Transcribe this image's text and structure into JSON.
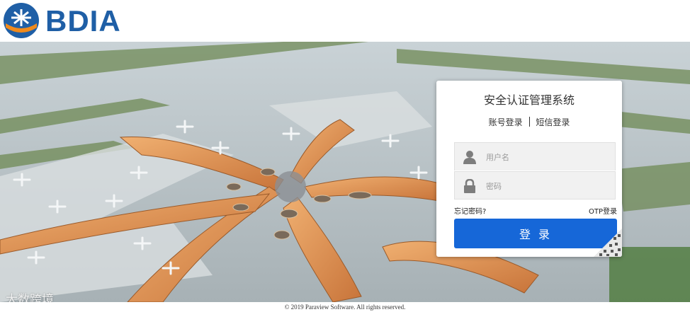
{
  "header": {
    "brand": "BDIA",
    "logo_icon": "bdia-logo-icon"
  },
  "colors": {
    "brand_blue": "#1f5fa6",
    "button_blue": "#1667d8",
    "logo_orange": "#f08a1c"
  },
  "login": {
    "title": "安全认证管理系统",
    "tabs": [
      "账号登录",
      "短信登录"
    ],
    "username_placeholder": "用户名",
    "password_placeholder": "密码",
    "forgot_password": "忘记密码?",
    "otp_login": "OTP登录",
    "login_button": "登 录"
  },
  "watermark": "大数跨境",
  "footer": {
    "copyright": "© 2019 Paraview Software. All rights reserved."
  }
}
